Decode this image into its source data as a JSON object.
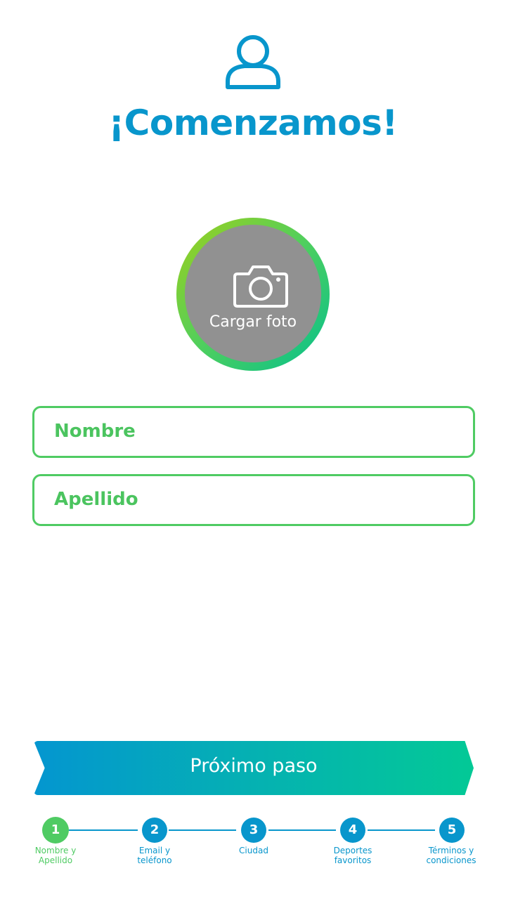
{
  "header": {
    "icon": "user-icon",
    "title": "¡Comenzamos!"
  },
  "photo": {
    "icon": "camera-icon",
    "label": "Cargar foto"
  },
  "form": {
    "first_name_placeholder": "Nombre",
    "last_name_placeholder": "Apellido"
  },
  "actions": {
    "next_label": "Próximo paso"
  },
  "stepper": {
    "current": 1,
    "steps": [
      {
        "number": "1",
        "label_line1": "Nombre y",
        "label_line2": "Apellido"
      },
      {
        "number": "2",
        "label_line1": "Email y",
        "label_line2": "teléfono"
      },
      {
        "number": "3",
        "label_line1": "Ciudad",
        "label_line2": ""
      },
      {
        "number": "4",
        "label_line1": "Deportes",
        "label_line2": "favoritos"
      },
      {
        "number": "5",
        "label_line1": "Términos y",
        "label_line2": "condiciones"
      }
    ]
  },
  "colors": {
    "primary_blue": "#0896cc",
    "accent_green": "#4fcb63",
    "gradient_teal": "#03c996",
    "photo_fill": "#919191"
  }
}
